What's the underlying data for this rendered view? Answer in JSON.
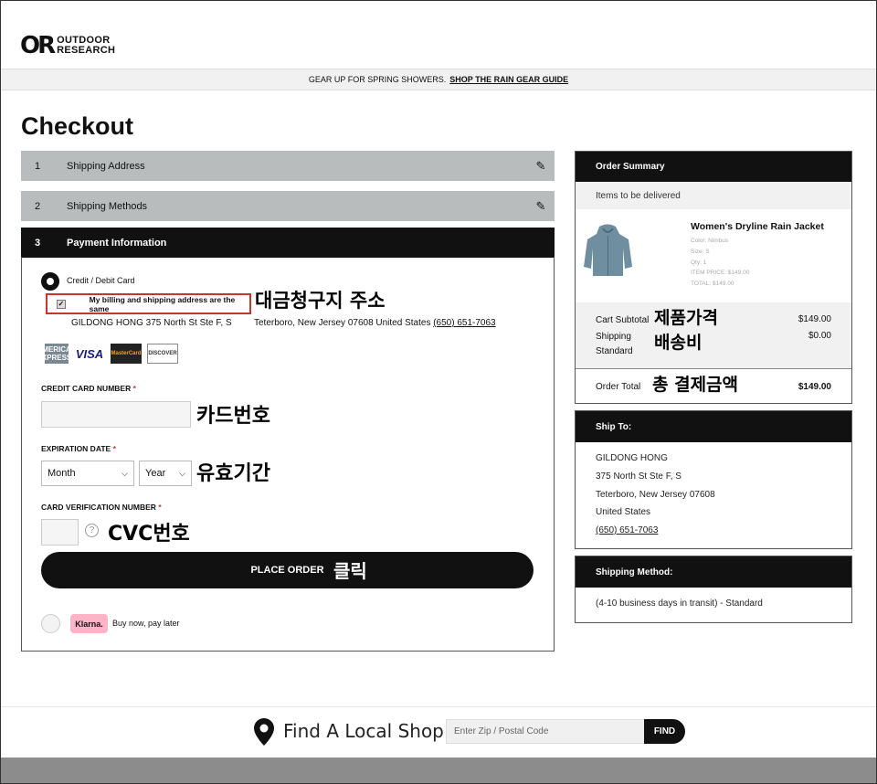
{
  "logo": {
    "mark": "OR",
    "line1": "OUTDOOR",
    "line2": "RESEARCH"
  },
  "promo": {
    "text": "GEAR UP FOR SPRING SHOWERS.",
    "link": "SHOP THE RAIN GEAR GUIDE"
  },
  "page_title": "Checkout",
  "steps": [
    {
      "num": "1",
      "label": "Shipping Address"
    },
    {
      "num": "2",
      "label": "Shipping Methods"
    },
    {
      "num": "3",
      "label": "Payment Information"
    }
  ],
  "payment": {
    "method_label": "Credit / Debit Card",
    "billing_same_label": "My billing and shipping address are the same",
    "billing_name_street": "GILDONG HONG 375 North St Ste F, S",
    "billing_city": "Teterboro, New Jersey 07608 United States",
    "billing_phone": "(650) 651-7063",
    "cards": {
      "amex": "AMERICAN EXPRESS",
      "visa": "VISA",
      "mc": "MasterCard",
      "discover": "DISCOVER"
    },
    "card_number_label": "CREDIT CARD NUMBER",
    "expiration_label": "EXPIRATION DATE",
    "month_value": "Month",
    "year_value": "Year",
    "cvv_label": "CARD VERIFICATION NUMBER",
    "required_mark": "*",
    "help_glyph": "?",
    "place_order": "PLACE ORDER",
    "klarna_badge": "Klarna.",
    "klarna_label": "Buy now, pay later"
  },
  "annotations": {
    "billing": "대금청구지 주소",
    "card_number": "카드번호",
    "expiry": "유효기간",
    "cvc": "CVC번호",
    "click": "클릭",
    "product_price": "제품가격",
    "shipping_fee": "배송비",
    "total_payment": "총 결제금액"
  },
  "order_summary": {
    "title": "Order Summary",
    "items_label": "Items to be delivered",
    "product": {
      "name": "Women's Dryline Rain Jacket",
      "color": "Color: Nimbus",
      "size": "Size: S",
      "qty": "Qty: 1",
      "item_price": "ITEM PRICE: $149.00",
      "total": "TOTAL: $149.00"
    },
    "cart_subtotal_label": "Cart Subtotal",
    "cart_subtotal_value": "$149.00",
    "shipping_label": "Shipping",
    "shipping_sub": "Standard",
    "shipping_value": "$0.00",
    "order_total_label": "Order Total",
    "order_total_value": "$149.00"
  },
  "ship_to": {
    "title": "Ship To:",
    "name": "GILDONG HONG",
    "street": "375 North St Ste F, S",
    "city": "Teterboro, New Jersey 07608",
    "country": "United States",
    "phone": "(650) 651-7063"
  },
  "shipping_method": {
    "title": "Shipping Method:",
    "value": "(4-10 business days in transit) - Standard"
  },
  "footer": {
    "title": "Find A Local Shop",
    "zip_placeholder": "Enter Zip / Postal Code",
    "find_button": "FIND"
  }
}
